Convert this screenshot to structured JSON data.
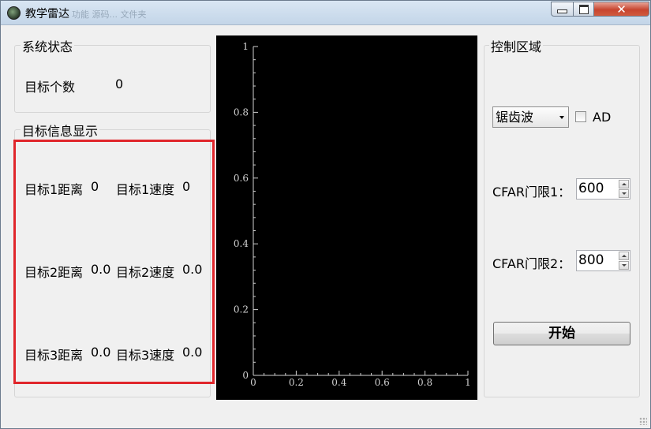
{
  "window": {
    "title": "教学雷达",
    "background_text": "功能 源码... 文件夹",
    "close_glyph": "✕"
  },
  "status": {
    "title": "系统状态",
    "target_count_label": "目标个数",
    "target_count_value": "0"
  },
  "target_info": {
    "title": "目标信息显示",
    "rows": [
      {
        "dist_label": "目标1距离",
        "dist_value": "0",
        "speed_label": "目标1速度",
        "speed_value": "0"
      },
      {
        "dist_label": "目标2距离",
        "dist_value": "0.0",
        "speed_label": "目标2速度",
        "speed_value": "0.0"
      },
      {
        "dist_label": "目标3距离",
        "dist_value": "0.0",
        "speed_label": "目标3速度",
        "speed_value": "0.0"
      }
    ]
  },
  "chart_data": {
    "type": "line",
    "xlim": [
      0,
      1
    ],
    "ylim": [
      0,
      1
    ],
    "x_ticks": [
      "0",
      "0.2",
      "0.4",
      "0.6",
      "0.8",
      "1"
    ],
    "y_ticks": [
      "0",
      "0.2",
      "0.4",
      "0.6",
      "0.8",
      "1"
    ],
    "series": [],
    "background": "#000000",
    "axis_color": "#d0d0d0"
  },
  "control": {
    "title": "控制区域",
    "waveform_selected": "锯齿波",
    "ad_label": "AD",
    "ad_checked": false,
    "cfar1_label": "CFAR门限1：",
    "cfar1_value": "600",
    "cfar2_label": "CFAR门限2：",
    "cfar2_value": "800",
    "start_label": "开始"
  },
  "colors": {
    "highlight_box": "#e0262b",
    "close_button": "#c7452f"
  }
}
